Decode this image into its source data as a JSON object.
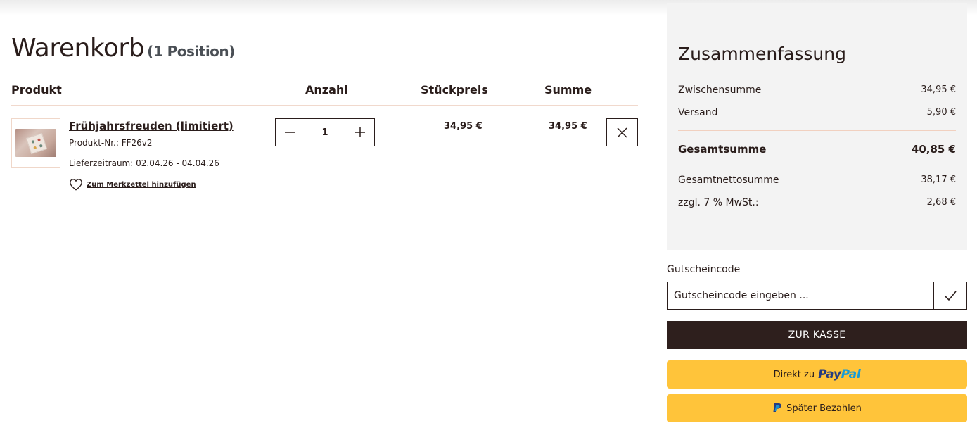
{
  "cart": {
    "title": "Warenkorb",
    "count_label": "(1 Position)",
    "columns": {
      "product": "Produkt",
      "quantity": "Anzahl",
      "unit_price": "Stückpreis",
      "total": "Summe"
    },
    "items": [
      {
        "name": "Frühjahrsfreuden (limitiert)",
        "product_nr": "Produkt-Nr.: FF26v2",
        "delivery": "Lieferzeitraum: 02.04.26 - 04.04.26",
        "wishlist_label": "Zum Merkzettel hinzufügen",
        "quantity": "1",
        "unit_price": "34,95 €",
        "total": "34,95 €"
      }
    ]
  },
  "summary": {
    "title": "Zusammenfassung",
    "subtotal_label": "Zwischensumme",
    "subtotal": "34,95 €",
    "shipping_label": "Versand",
    "shipping": "5,90 €",
    "grand_total_label": "Gesamtsumme",
    "grand_total": "40,85 €",
    "net_total_label": "Gesamtnettosumme",
    "net_total": "38,17 €",
    "vat_label": "zzgl. 7 % MwSt.:",
    "vat": "2,68 €"
  },
  "coupon": {
    "label": "Gutscheincode",
    "placeholder": "Gutscheincode eingeben ..."
  },
  "checkout": {
    "label": "ZUR KASSE"
  },
  "paypal": {
    "direct_prefix": "Direkt zu",
    "logo_part1": "Pay",
    "logo_part2": "Pal",
    "later_label": "Später Bezahlen"
  },
  "colors": {
    "dark": "#2e1f1d",
    "paypal_yellow": "#ffc43a",
    "accent_rule": "#f1d9cd",
    "summary_bg": "#f3f3f3"
  }
}
